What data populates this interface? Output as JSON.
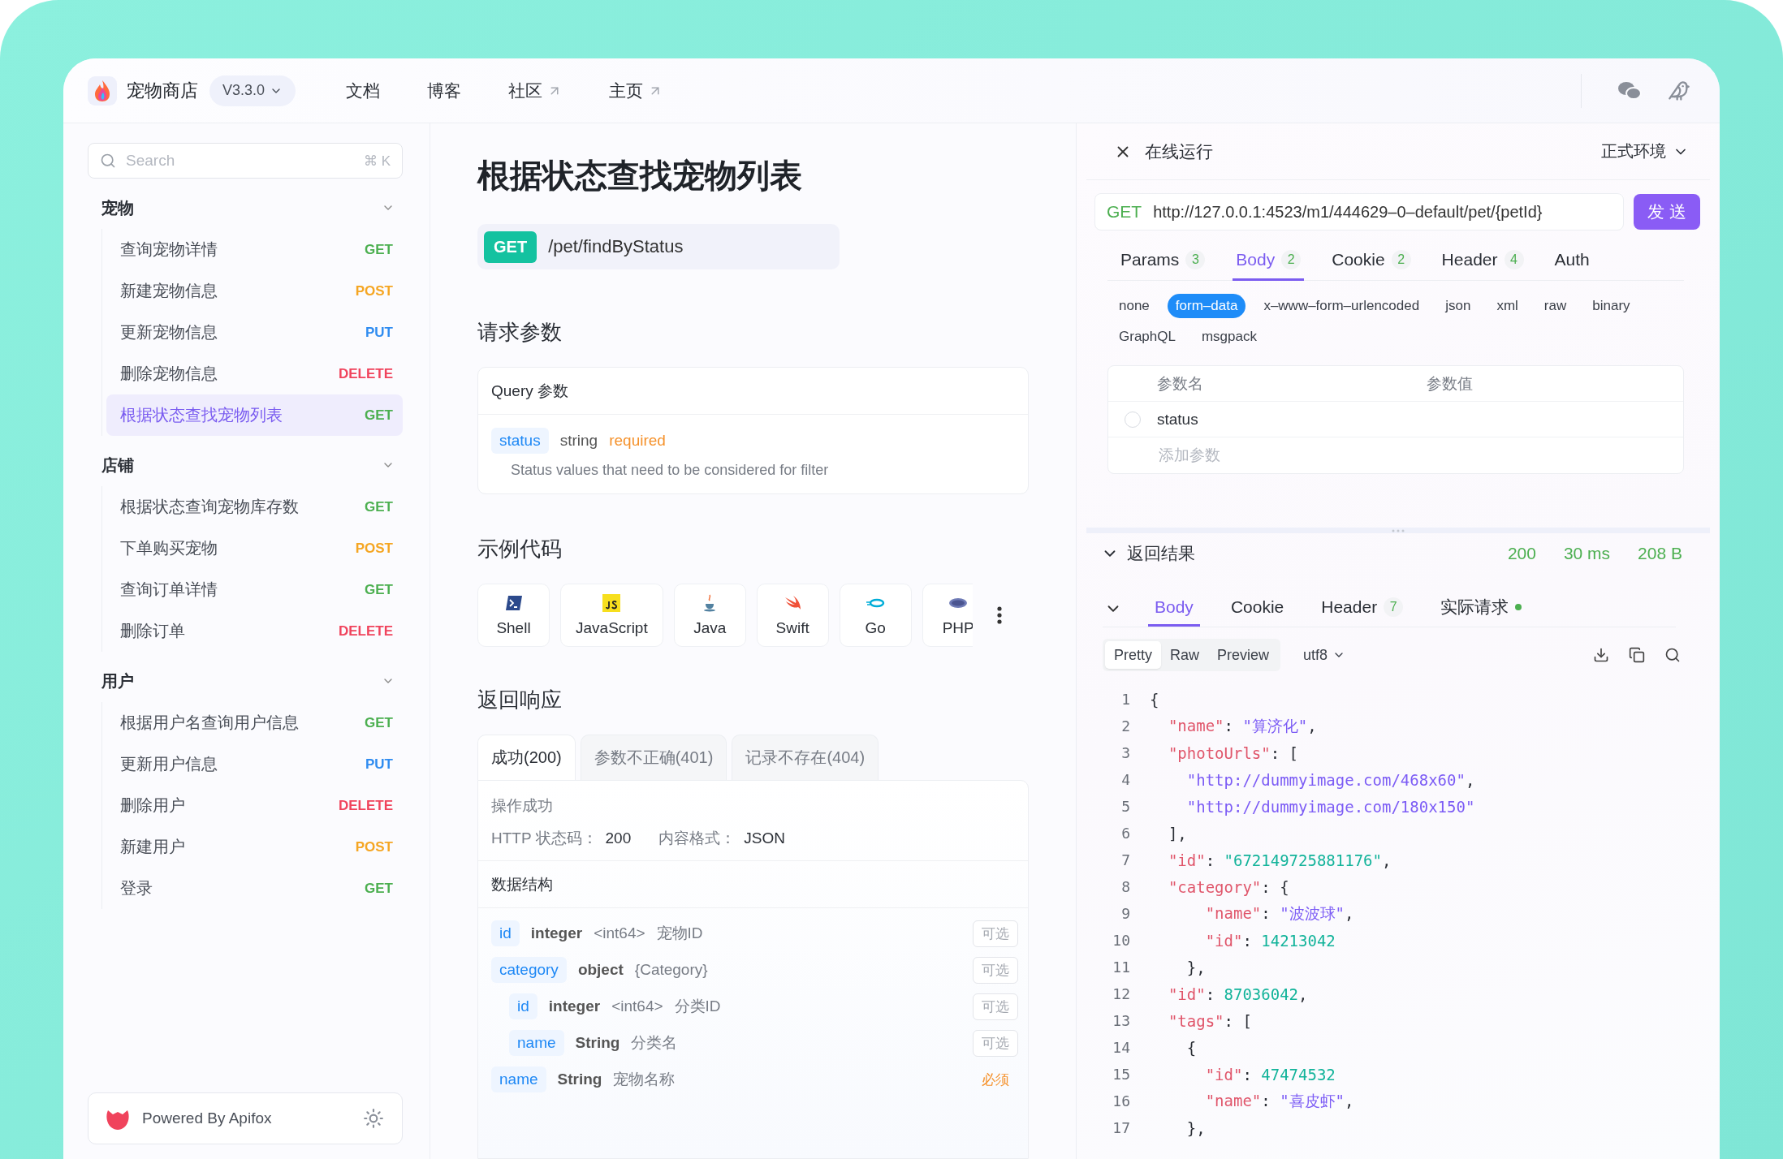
{
  "header": {
    "app_name": "宠物商店",
    "version": "V3.3.0",
    "nav": [
      {
        "label": "文档",
        "external": false
      },
      {
        "label": "博客",
        "external": false
      },
      {
        "label": "社区",
        "external": true
      },
      {
        "label": "主页",
        "external": true
      }
    ]
  },
  "sidebar": {
    "search": {
      "placeholder": "Search",
      "shortcut": "⌘ K"
    },
    "groups": [
      {
        "title": "宠物",
        "expanded": true,
        "items": [
          {
            "name": "查询宠物详情",
            "method": "GET",
            "color": "#4caf50",
            "selected": false
          },
          {
            "name": "新建宠物信息",
            "method": "POST",
            "color": "#f5a623",
            "selected": false
          },
          {
            "name": "更新宠物信息",
            "method": "PUT",
            "color": "#2f8cf0",
            "selected": false
          },
          {
            "name": "删除宠物信息",
            "method": "DELETE",
            "color": "#f0435c",
            "selected": false
          },
          {
            "name": "根据状态查找宠物列表",
            "method": "GET",
            "color": "#4caf50",
            "selected": true
          }
        ]
      },
      {
        "title": "店铺",
        "expanded": true,
        "items": [
          {
            "name": "根据状态查询宠物库存数",
            "method": "GET",
            "color": "#4caf50",
            "selected": false
          },
          {
            "name": "下单购买宠物",
            "method": "POST",
            "color": "#f5a623",
            "selected": false
          },
          {
            "name": "查询订单详情",
            "method": "GET",
            "color": "#4caf50",
            "selected": false
          },
          {
            "name": "删除订单",
            "method": "DELETE",
            "color": "#f0435c",
            "selected": false
          }
        ]
      },
      {
        "title": "用户",
        "expanded": true,
        "items": [
          {
            "name": "根据用户名查询用户信息",
            "method": "GET",
            "color": "#4caf50",
            "selected": false
          },
          {
            "name": "更新用户信息",
            "method": "PUT",
            "color": "#2f8cf0",
            "selected": false
          },
          {
            "name": "删除用户",
            "method": "DELETE",
            "color": "#f0435c",
            "selected": false
          },
          {
            "name": "新建用户",
            "method": "POST",
            "color": "#f5a623",
            "selected": false
          },
          {
            "name": "登录",
            "method": "GET",
            "color": "#4caf50",
            "selected": false
          }
        ]
      }
    ],
    "footer": "Powered By Apifox"
  },
  "main": {
    "title": "根据状态查找宠物列表",
    "endpoint": {
      "method": "GET",
      "path": "/pet/findByStatus"
    },
    "request_params": {
      "heading": "请求参数",
      "card_title": "Query 参数",
      "params": [
        {
          "name": "status",
          "type": "string",
          "requirement": "required",
          "description": "Status values that need to be considered for filter"
        }
      ]
    },
    "code_samples": {
      "heading": "示例代码",
      "languages": [
        {
          "kind": "shell",
          "label": "Shell"
        },
        {
          "kind": "javascript",
          "label": "JavaScript"
        },
        {
          "kind": "java",
          "label": "Java"
        },
        {
          "kind": "swift",
          "label": "Swift"
        },
        {
          "kind": "go",
          "label": "Go"
        },
        {
          "kind": "php",
          "label": "PHP"
        }
      ]
    },
    "response": {
      "heading": "返回响应",
      "tabs": [
        {
          "label": "成功(200)",
          "selected": true
        },
        {
          "label": "参数不正确(401)",
          "selected": false
        },
        {
          "label": "记录不存在(404)",
          "selected": false
        }
      ],
      "message": "操作成功",
      "status_label": "HTTP 状态码：",
      "status_value": "200",
      "format_label": "内容格式：",
      "format_value": "JSON",
      "schema_title": "数据结构",
      "fields": [
        {
          "name": "id",
          "type": "integer",
          "format": "<int64>",
          "description": "宠物ID",
          "required": false,
          "requirement": "可选"
        },
        {
          "name": "category",
          "type": "object",
          "format": "{Category}",
          "required": false,
          "requirement": "可选",
          "children": [
            {
              "name": "id",
              "type": "integer",
              "format": "<int64>",
              "description": "分类ID",
              "required": false,
              "requirement": "可选"
            },
            {
              "name": "name",
              "type": "String",
              "description": "分类名",
              "required": false,
              "requirement": "可选"
            }
          ]
        },
        {
          "name": "name",
          "type": "String",
          "description": "宠物名称",
          "required": true,
          "requirement": "必须"
        }
      ]
    }
  },
  "run_panel": {
    "title": "在线运行",
    "environment": "正式环境",
    "request": {
      "method": "GET",
      "url": "http://127.0.0.1:4523/m1/444629–0–default/pet/{petId}",
      "send": "发 送"
    },
    "tabs": [
      {
        "label": "Params",
        "count": "3",
        "selected": false
      },
      {
        "label": "Body",
        "count": "2",
        "selected": true
      },
      {
        "label": "Cookie",
        "count": "2",
        "selected": false
      },
      {
        "label": "Header",
        "count": "4",
        "selected": false
      },
      {
        "label": "Auth",
        "selected": false
      }
    ],
    "body_types": [
      {
        "label": "none",
        "selected": false
      },
      {
        "label": "form–data",
        "selected": true
      },
      {
        "label": "x–www–form–urlencoded",
        "selected": false
      },
      {
        "label": "json",
        "selected": false
      },
      {
        "label": "xml",
        "selected": false
      },
      {
        "label": "raw",
        "selected": false
      },
      {
        "label": "binary",
        "selected": false
      },
      {
        "label": "GraphQL",
        "selected": false
      },
      {
        "label": "msgpack",
        "selected": false
      }
    ],
    "params_table": {
      "columns": [
        "参数名",
        "参数值"
      ],
      "rows": [
        {
          "checked": false,
          "name": "status"
        }
      ],
      "add_placeholder": "添加参数"
    },
    "result": {
      "title": "返回结果",
      "expanded": true,
      "status": "200",
      "time": "30 ms",
      "size": "208 B"
    },
    "response_tabs": [
      {
        "label": "Body",
        "selected": true
      },
      {
        "label": "Cookie",
        "selected": false
      },
      {
        "label": "Header",
        "count": "7",
        "selected": false
      },
      {
        "label": "实际请求",
        "selected": false,
        "indicator": true
      }
    ],
    "view_modes": [
      {
        "label": "Pretty",
        "selected": true
      },
      {
        "label": "Raw",
        "selected": false
      },
      {
        "label": "Preview",
        "selected": false
      }
    ],
    "encoding": "utf8",
    "code_lines": [
      {
        "number": "1",
        "tokens": [
          {
            "kind": "punct",
            "text": "{"
          }
        ]
      },
      {
        "number": "2",
        "tokens": [
          {
            "kind": "key",
            "text": "  \"name\""
          },
          {
            "kind": "punct",
            "text": ": "
          },
          {
            "kind": "string",
            "text": "\"算济化\""
          },
          {
            "kind": "punct",
            "text": ","
          }
        ]
      },
      {
        "number": "3",
        "tokens": [
          {
            "kind": "key",
            "text": "  \"photoUrls\""
          },
          {
            "kind": "punct",
            "text": ": ["
          }
        ]
      },
      {
        "number": "4",
        "tokens": [
          {
            "kind": "string",
            "text": "    \"http://dummyimage.com/468x60\""
          },
          {
            "kind": "punct",
            "text": ","
          }
        ]
      },
      {
        "number": "5",
        "tokens": [
          {
            "kind": "string",
            "text": "    \"http://dummyimage.com/180x150\""
          }
        ]
      },
      {
        "number": "6",
        "tokens": [
          {
            "kind": "punct",
            "text": "  ],"
          }
        ]
      },
      {
        "number": "7",
        "tokens": [
          {
            "kind": "key",
            "text": "  \"id\""
          },
          {
            "kind": "punct",
            "text": ": "
          },
          {
            "kind": "number",
            "text": "\"672149725881176\""
          },
          {
            "kind": "punct",
            "text": ","
          }
        ]
      },
      {
        "number": "8",
        "tokens": [
          {
            "kind": "key",
            "text": "  \"category\""
          },
          {
            "kind": "punct",
            "text": ": {"
          }
        ]
      },
      {
        "number": "9",
        "tokens": [
          {
            "kind": "key",
            "text": "      \"name\""
          },
          {
            "kind": "punct",
            "text": ": "
          },
          {
            "kind": "string",
            "text": "\"波波球\""
          },
          {
            "kind": "punct",
            "text": ","
          }
        ]
      },
      {
        "number": "10",
        "tokens": [
          {
            "kind": "key",
            "text": "      \"id\""
          },
          {
            "kind": "punct",
            "text": ": "
          },
          {
            "kind": "number",
            "text": "14213042"
          }
        ]
      },
      {
        "number": "11",
        "tokens": [
          {
            "kind": "punct",
            "text": "    },"
          }
        ]
      },
      {
        "number": "12",
        "tokens": [
          {
            "kind": "key",
            "text": "  \"id\""
          },
          {
            "kind": "punct",
            "text": ": "
          },
          {
            "kind": "number",
            "text": "87036042"
          },
          {
            "kind": "punct",
            "text": ","
          }
        ]
      },
      {
        "number": "13",
        "tokens": [
          {
            "kind": "key",
            "text": "  \"tags\""
          },
          {
            "kind": "punct",
            "text": ": ["
          }
        ]
      },
      {
        "number": "14",
        "tokens": [
          {
            "kind": "punct",
            "text": "    {"
          }
        ]
      },
      {
        "number": "15",
        "tokens": [
          {
            "kind": "key",
            "text": "      \"id\""
          },
          {
            "kind": "punct",
            "text": ": "
          },
          {
            "kind": "number",
            "text": "47474532"
          }
        ]
      },
      {
        "number": "16",
        "tokens": [
          {
            "kind": "key",
            "text": "      \"name\""
          },
          {
            "kind": "punct",
            "text": ": "
          },
          {
            "kind": "string",
            "text": "\"喜皮虾\""
          },
          {
            "kind": "punct",
            "text": ","
          }
        ]
      },
      {
        "number": "17",
        "tokens": [
          {
            "kind": "punct",
            "text": "    },"
          }
        ]
      }
    ]
  }
}
